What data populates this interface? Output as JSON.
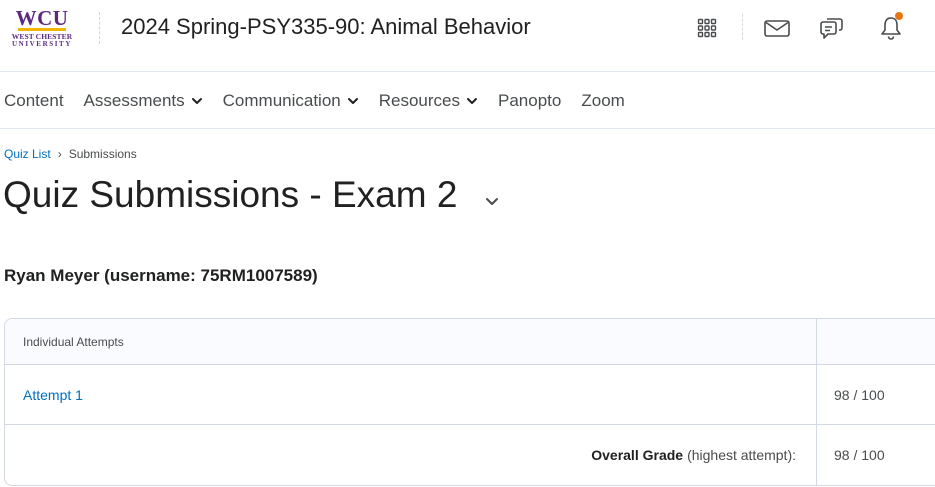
{
  "header": {
    "logo": {
      "main": "WCU",
      "sub1": "WEST CHESTER",
      "sub2": "UNIVERSITY"
    },
    "course_title": "2024 Spring-PSY335-90: Animal Behavior",
    "icons": [
      "apps-grid-icon",
      "mail-icon",
      "chat-icon",
      "bell-icon"
    ],
    "notification_dot_color": "#e87511"
  },
  "nav": {
    "items": [
      {
        "label": "Content",
        "dropdown": false
      },
      {
        "label": "Assessments",
        "dropdown": true
      },
      {
        "label": "Communication",
        "dropdown": true
      },
      {
        "label": "Resources",
        "dropdown": true
      },
      {
        "label": "Panopto",
        "dropdown": false
      },
      {
        "label": "Zoom",
        "dropdown": false
      }
    ]
  },
  "breadcrumb": {
    "link": "Quiz List",
    "separator": "›",
    "current": "Submissions"
  },
  "page_title": "Quiz Submissions - Exam 2",
  "user_heading": "Ryan Meyer (username: 75RM1007589)",
  "table": {
    "header": "Individual Attempts",
    "attempt": {
      "label": "Attempt 1",
      "score": "98 / 100"
    },
    "overall": {
      "label_bold": "Overall Grade",
      "label_rest": "(highest attempt):",
      "score": "98 / 100"
    }
  },
  "colors": {
    "link": "#006fbf",
    "brand_purple": "#5b2a82",
    "brand_gold": "#f2b500"
  }
}
